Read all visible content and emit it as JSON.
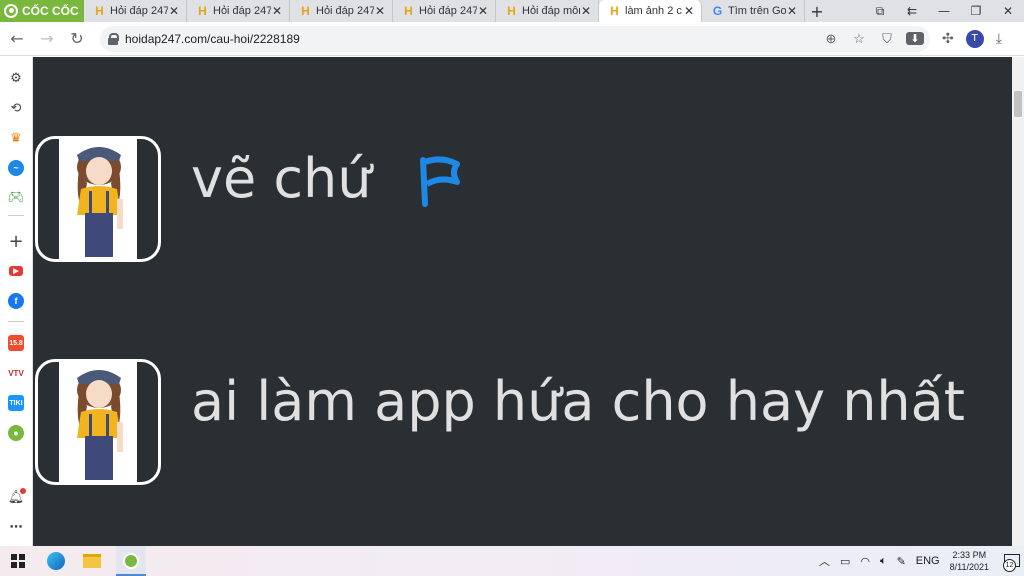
{
  "browser": {
    "brand": "CỐC CỐC",
    "tabs": [
      {
        "label": "Hỏi đáp 247",
        "favicon": "H",
        "active": false
      },
      {
        "label": "Hỏi đáp 247",
        "favicon": "H",
        "active": false
      },
      {
        "label": "Hỏi đáp 247",
        "favicon": "H",
        "active": false
      },
      {
        "label": "Hỏi đáp 247",
        "favicon": "H",
        "active": false
      },
      {
        "label": "Hỏi đáp môn",
        "favicon": "H",
        "active": false
      },
      {
        "label": "làm ảnh 2 c",
        "favicon": "H",
        "active": true
      },
      {
        "label": "Tìm trên Go",
        "favicon": "G",
        "active": false
      }
    ],
    "url": "hoidap247.com/cau-hoi/2228189",
    "profile_initial": "T"
  },
  "content": {
    "posts": [
      {
        "text": "vẽ chứ"
      },
      {
        "text": "ai làm app hứa cho hay nhất"
      }
    ]
  },
  "taskbar": {
    "language": "ENG",
    "time": "2:33 PM",
    "date": "8/11/2021",
    "notification_count": "12"
  },
  "colors": {
    "content_bg": "#292f32",
    "flag_blue": "#1e88e5",
    "coccoc_green": "#79b83c"
  }
}
